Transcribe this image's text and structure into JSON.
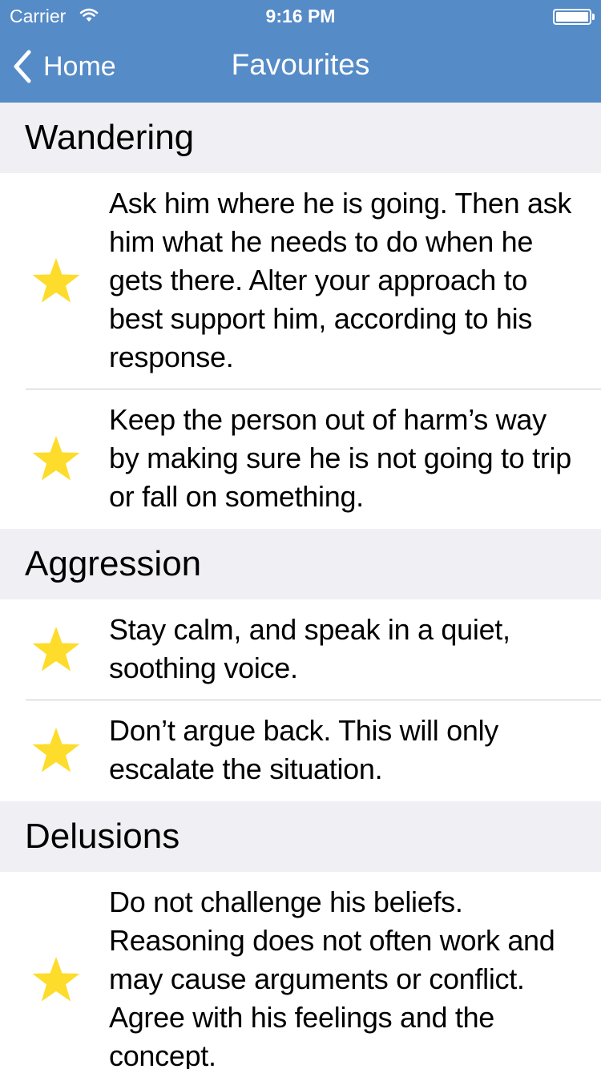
{
  "status_bar": {
    "carrier": "Carrier",
    "time": "9:16 PM"
  },
  "nav": {
    "back_label": "Home",
    "title": "Favourites"
  },
  "colors": {
    "nav_background": "#558bc7",
    "section_background": "#efeff4",
    "star": "#fddc2b"
  },
  "sections": [
    {
      "title": "Wandering",
      "items": [
        {
          "icon": "star-icon",
          "text": "Ask him where he is going. Then ask him what he needs to do when he gets there. Alter your approach to best support him, according to his response."
        },
        {
          "icon": "star-icon",
          "text": "Keep the person out of harm’s way by making sure he is not going to trip or fall on something."
        }
      ]
    },
    {
      "title": "Aggression",
      "items": [
        {
          "icon": "star-icon",
          "text": "Stay calm, and speak in a quiet, soothing voice."
        },
        {
          "icon": "star-icon",
          "text": "Don’t argue back. This will only escalate the situation."
        }
      ]
    },
    {
      "title": "Delusions",
      "items": [
        {
          "icon": "star-icon",
          "text": "Do not challenge his beliefs. Reasoning does not often work and may cause arguments or conflict. Agree with his feelings and the concept."
        }
      ]
    }
  ]
}
